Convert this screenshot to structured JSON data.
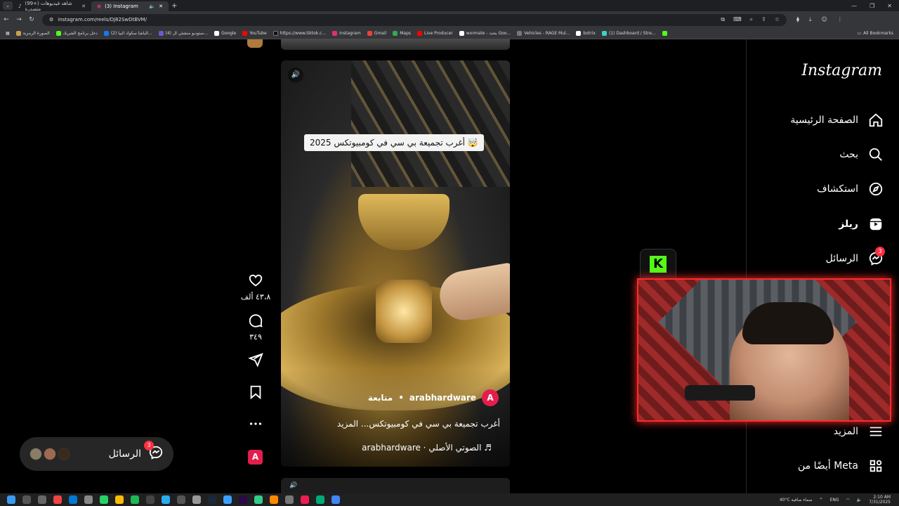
{
  "browser": {
    "tabs": [
      {
        "title": "(99+) شاهد فيديوهات متصدرة",
        "active": false
      },
      {
        "title": "(3) Instagram",
        "active": true
      }
    ],
    "url": "instagram.com/reels/DJ82SwDtBVM/",
    "bookmarks": [
      {
        "label": "الصورة الرمزية",
        "color": "#c8a050"
      },
      {
        "label": "دخل برنامج الشريك",
        "color": "#53fc18"
      },
      {
        "label": "(2) الباشا سكواد البيا...",
        "color": "#1877f2"
      },
      {
        "label": "(4) ستوديو منشئي ال...",
        "color": "#6a5acd"
      },
      {
        "label": "Google",
        "color": "#ffffff"
      },
      {
        "label": "YouTube",
        "color": "#ff0000"
      },
      {
        "label": "https://www.tiktok.c...",
        "color": "#111111"
      },
      {
        "label": "Instagram",
        "color": "#e1306c"
      },
      {
        "label": "Gmail",
        "color": "#ea4335"
      },
      {
        "label": "Maps",
        "color": "#34a853"
      },
      {
        "label": "Live Producer",
        "color": "#ff0000"
      },
      {
        "label": "wormate - بحث Goo...",
        "color": "#ffffff"
      },
      {
        "label": "Vehicles - RAGE Mul...",
        "color": "#777777"
      },
      {
        "label": "botrix",
        "color": "#ffffff"
      },
      {
        "label": "(1) Dashboard / Stre...",
        "color": "#3cd0c8"
      },
      {
        "label": "",
        "color": "#53fc18"
      }
    ],
    "all_bookmarks": "All Bookmarks"
  },
  "sidebar": {
    "logo": "Instagram",
    "items": [
      {
        "label": "الصفحة الرئيسية",
        "icon": "home-icon"
      },
      {
        "label": "بحث",
        "icon": "search-icon"
      },
      {
        "label": "استكشاف",
        "icon": "compass-icon"
      },
      {
        "label": "ريلز",
        "icon": "reels-icon"
      },
      {
        "label": "الرسائل",
        "icon": "messenger-icon",
        "badge": "3"
      },
      {
        "label": "المزيد",
        "icon": "menu-icon"
      },
      {
        "label": "أيضًا من Meta",
        "icon": "grid-icon"
      }
    ]
  },
  "reel": {
    "overlay_caption": "أغرب تجميعة بي سي في كومبيوتكس 2025 🤯",
    "username": "arabhardware",
    "follow": "متابعة",
    "separator": "•",
    "description": "أغرب تجميعة بي سي في كومبيوتكس... المزيد",
    "audio": "arabhardware · الصوتي الأصلي ♬"
  },
  "actions": {
    "likes": "٤٣،٨ ألف",
    "comments": "٣٤٩"
  },
  "messages_pill": {
    "label": "الرسائل",
    "badge": "3"
  },
  "taskbar": {
    "weather": "40°C سماء صافية",
    "lang": "ENG",
    "time": "2:10 AM",
    "date": "7/31/2025"
  }
}
